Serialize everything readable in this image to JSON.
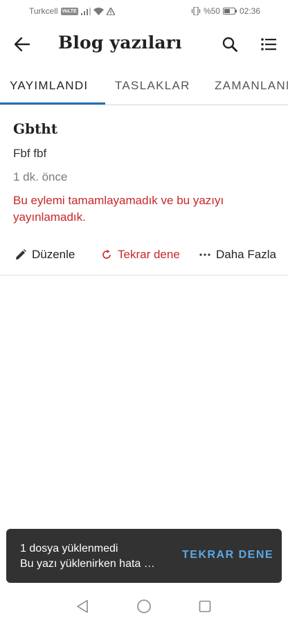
{
  "status_bar": {
    "carrier": "Turkcell",
    "volte": "VoLTE",
    "battery": "%50",
    "time": "02:36"
  },
  "app_bar": {
    "title": "Blog yazıları",
    "back_icon": "arrow-left-icon",
    "search_icon": "search-icon",
    "list_icon": "list-icon"
  },
  "tabs": [
    {
      "label": "YAYIMLANDI",
      "active": true
    },
    {
      "label": "TASLAKLAR",
      "active": false
    },
    {
      "label": "ZAMANLANMIŞ",
      "active": false
    }
  ],
  "post": {
    "title": "Gbtht",
    "excerpt": "Fbf fbf",
    "time": "1 dk. önce",
    "error": "Bu eylemi tamamlayamadık ve bu yazıyı yayınlamadık.",
    "actions": {
      "edit": "Düzenle",
      "retry": "Tekrar dene",
      "more": "Daha Fazla"
    }
  },
  "snackbar": {
    "line1": "1 dosya yüklenmedi",
    "line2": "Bu yazı yüklenirken hata oluştu",
    "action": "TEKRAR DENE"
  },
  "colors": {
    "accent": "#2271b1",
    "error": "#c62828",
    "snackbar_bg": "#323232",
    "snackbar_action": "#5aa8e6"
  }
}
